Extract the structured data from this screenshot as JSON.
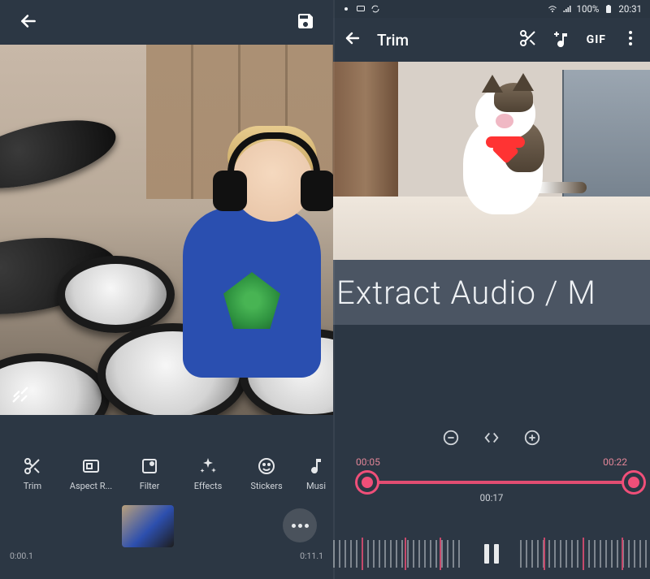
{
  "left": {
    "timeline_start": "0:00.1",
    "timeline_end": "0:11.1",
    "tools": [
      {
        "name": "trim",
        "label": "Trim"
      },
      {
        "name": "aspect",
        "label": "Aspect R..."
      },
      {
        "name": "filter",
        "label": "Filter"
      },
      {
        "name": "effects",
        "label": "Effects"
      },
      {
        "name": "stickers",
        "label": "Stickers"
      },
      {
        "name": "music",
        "label": "Musi"
      }
    ]
  },
  "right": {
    "status": {
      "battery": "100%",
      "time": "20:31"
    },
    "title": "Trim",
    "banner": "Extract Audio / M",
    "trim": {
      "start": "00:05",
      "end": "00:22",
      "current": "00:17"
    }
  }
}
